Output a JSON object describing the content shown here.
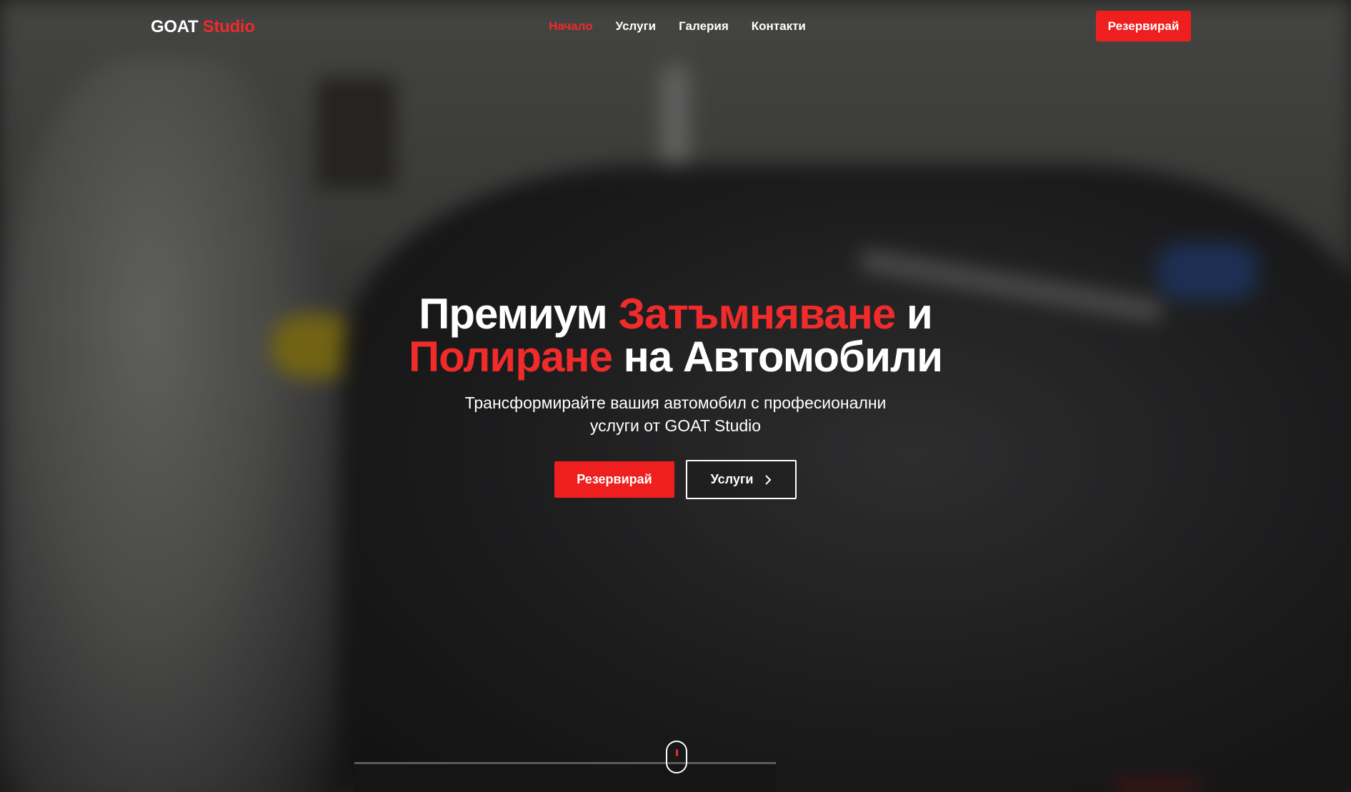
{
  "brand": {
    "name_part1": "GOAT",
    "name_part2": "Studio",
    "accent_color": "#ef2b2b"
  },
  "nav": {
    "items": [
      {
        "label": "Начало",
        "active": true
      },
      {
        "label": "Услуги",
        "active": false
      },
      {
        "label": "Галерия",
        "active": false
      },
      {
        "label": "Контакти",
        "active": false
      }
    ],
    "cta_label": "Резервирай"
  },
  "hero": {
    "title_part1": "Премиум ",
    "title_accent1": "Затъмняване",
    "title_part2": " и",
    "title_accent2": "Полиране",
    "title_part3": " на Автомобили",
    "subtitle": "Трансформирайте вашия автомобил с професионални услуги от GOAT Studio",
    "primary_button": "Резервирай",
    "secondary_button": "Услуги",
    "secondary_icon": "chevron-right-icon",
    "scroll_icon": "mouse-scroll-icon"
  }
}
